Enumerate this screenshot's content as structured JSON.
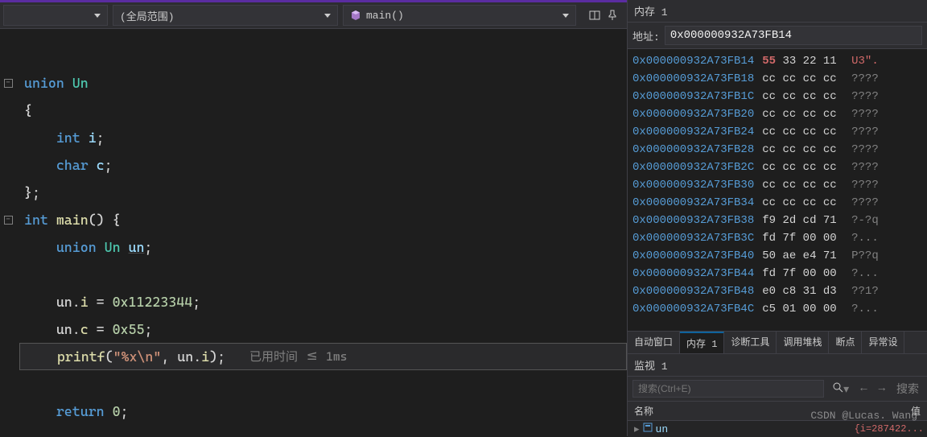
{
  "toolbar": {
    "scope_label": "(全局范围)",
    "function_label": "main()"
  },
  "code": {
    "lines": [
      {
        "outline": "box",
        "tokens": [
          {
            "c": "tok-keyword",
            "t": "union "
          },
          {
            "c": "tok-type",
            "t": "Un"
          }
        ]
      },
      {
        "tokens": [
          {
            "c": "tok-punct",
            "t": "{"
          }
        ]
      },
      {
        "tokens": [
          {
            "c": "tok-punct",
            "t": "    "
          },
          {
            "c": "tok-keyword",
            "t": "int "
          },
          {
            "c": "tok-var",
            "t": "i"
          },
          {
            "c": "tok-punct",
            "t": ";"
          }
        ]
      },
      {
        "tokens": [
          {
            "c": "tok-punct",
            "t": "    "
          },
          {
            "c": "tok-keyword",
            "t": "char "
          },
          {
            "c": "tok-var",
            "t": "c"
          },
          {
            "c": "tok-punct",
            "t": ";"
          }
        ]
      },
      {
        "tokens": [
          {
            "c": "tok-punct",
            "t": "};"
          }
        ]
      },
      {
        "outline": "box",
        "tokens": [
          {
            "c": "tok-keyword",
            "t": "int "
          },
          {
            "c": "tok-ident",
            "t": "main"
          },
          {
            "c": "tok-punct",
            "t": "() {"
          }
        ]
      },
      {
        "tokens": [
          {
            "c": "tok-punct",
            "t": "    "
          },
          {
            "c": "tok-keyword",
            "t": "union "
          },
          {
            "c": "tok-type",
            "t": "Un "
          },
          {
            "c": "tok-var tok-underline",
            "t": "un"
          },
          {
            "c": "tok-punct",
            "t": ";"
          }
        ]
      },
      {
        "tokens": [
          {
            "c": "tok-punct",
            "t": ""
          }
        ]
      },
      {
        "tokens": [
          {
            "c": "tok-punct",
            "t": "    un."
          },
          {
            "c": "tok-field",
            "t": "i"
          },
          {
            "c": "tok-punct",
            "t": " = "
          },
          {
            "c": "tok-num",
            "t": "0x11223344"
          },
          {
            "c": "tok-punct",
            "t": ";"
          }
        ]
      },
      {
        "tokens": [
          {
            "c": "tok-punct",
            "t": "    un."
          },
          {
            "c": "tok-field",
            "t": "c"
          },
          {
            "c": "tok-punct",
            "t": " = "
          },
          {
            "c": "tok-num",
            "t": "0x55"
          },
          {
            "c": "tok-punct",
            "t": ";"
          }
        ]
      },
      {
        "current": true,
        "tokens": [
          {
            "c": "tok-punct",
            "t": "    "
          },
          {
            "c": "tok-ident",
            "t": "printf"
          },
          {
            "c": "tok-punct",
            "t": "("
          },
          {
            "c": "tok-str",
            "t": "\"%x\\n\""
          },
          {
            "c": "tok-punct",
            "t": ", un."
          },
          {
            "c": "tok-field",
            "t": "i"
          },
          {
            "c": "tok-punct",
            "t": ");   "
          },
          {
            "c": "tok-comment",
            "t": "已用时间 <= 1ms"
          }
        ]
      },
      {
        "tokens": [
          {
            "c": "tok-punct",
            "t": ""
          }
        ]
      },
      {
        "tokens": [
          {
            "c": "tok-punct",
            "t": "    "
          },
          {
            "c": "tok-keyword",
            "t": "return "
          },
          {
            "c": "tok-num",
            "t": "0"
          },
          {
            "c": "tok-punct",
            "t": ";"
          }
        ]
      }
    ]
  },
  "memory": {
    "title": "内存 1",
    "addr_label": "地址:",
    "addr_value": "0x000000932A73FB14",
    "rows": [
      {
        "addr": "0x000000932A73FB14",
        "b": [
          "55",
          "33",
          "22",
          "11"
        ],
        "hi": [
          0
        ],
        "ascii": "U3\"."
      },
      {
        "addr": "0x000000932A73FB18",
        "b": [
          "cc",
          "cc",
          "cc",
          "cc"
        ],
        "ascii": "????"
      },
      {
        "addr": "0x000000932A73FB1C",
        "b": [
          "cc",
          "cc",
          "cc",
          "cc"
        ],
        "ascii": "????"
      },
      {
        "addr": "0x000000932A73FB20",
        "b": [
          "cc",
          "cc",
          "cc",
          "cc"
        ],
        "ascii": "????"
      },
      {
        "addr": "0x000000932A73FB24",
        "b": [
          "cc",
          "cc",
          "cc",
          "cc"
        ],
        "ascii": "????"
      },
      {
        "addr": "0x000000932A73FB28",
        "b": [
          "cc",
          "cc",
          "cc",
          "cc"
        ],
        "ascii": "????"
      },
      {
        "addr": "0x000000932A73FB2C",
        "b": [
          "cc",
          "cc",
          "cc",
          "cc"
        ],
        "ascii": "????"
      },
      {
        "addr": "0x000000932A73FB30",
        "b": [
          "cc",
          "cc",
          "cc",
          "cc"
        ],
        "ascii": "????"
      },
      {
        "addr": "0x000000932A73FB34",
        "b": [
          "cc",
          "cc",
          "cc",
          "cc"
        ],
        "ascii": "????"
      },
      {
        "addr": "0x000000932A73FB38",
        "b": [
          "f9",
          "2d",
          "cd",
          "71"
        ],
        "ascii": "?-?q"
      },
      {
        "addr": "0x000000932A73FB3C",
        "b": [
          "fd",
          "7f",
          "00",
          "00"
        ],
        "ascii": "?..."
      },
      {
        "addr": "0x000000932A73FB40",
        "b": [
          "50",
          "ae",
          "e4",
          "71"
        ],
        "ascii": "P??q"
      },
      {
        "addr": "0x000000932A73FB44",
        "b": [
          "fd",
          "7f",
          "00",
          "00"
        ],
        "ascii": "?..."
      },
      {
        "addr": "0x000000932A73FB48",
        "b": [
          "e0",
          "c8",
          "31",
          "d3"
        ],
        "ascii": "??1?"
      },
      {
        "addr": "0x000000932A73FB4C",
        "b": [
          "c5",
          "01",
          "00",
          "00"
        ],
        "ascii": "?..."
      }
    ]
  },
  "tabs": {
    "items": [
      {
        "label": "自动窗口"
      },
      {
        "label": "内存 1",
        "active": true
      },
      {
        "label": "诊断工具"
      },
      {
        "label": "调用堆栈"
      },
      {
        "label": "断点"
      },
      {
        "label": "异常设"
      }
    ]
  },
  "watch": {
    "title": "监视 1",
    "search_placeholder": "搜索(Ctrl+E)",
    "search_label": "搜索",
    "col_name": "名称",
    "col_value": "值",
    "item_name": "un",
    "item_value": "{i=287422..."
  },
  "watermark": "CSDN @Lucas. Wang"
}
